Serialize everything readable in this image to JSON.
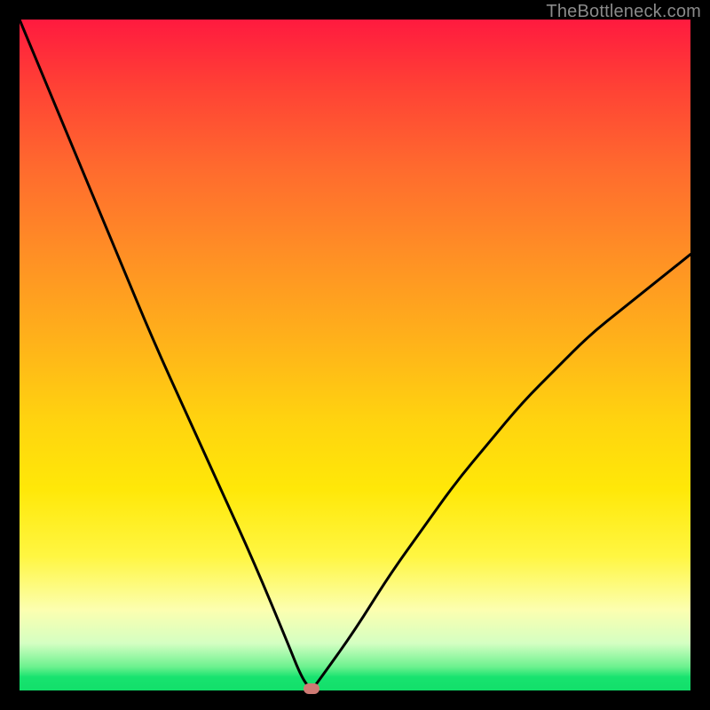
{
  "watermark": "TheBottleneck.com",
  "colors": {
    "frame": "#000000",
    "curve": "#000000",
    "marker": "#cf7a74",
    "gradient_top": "#ff1a3f",
    "gradient_bottom": "#12df6a"
  },
  "chart_data": {
    "type": "line",
    "title": "",
    "xlabel": "",
    "ylabel": "",
    "xlim": [
      0,
      100
    ],
    "ylim": [
      0,
      100
    ],
    "grid": false,
    "legend": false,
    "series": [
      {
        "name": "bottleneck-curve",
        "x": [
          0,
          5,
          10,
          15,
          20,
          25,
          30,
          35,
          40,
          42,
          43.5,
          45,
          50,
          55,
          60,
          65,
          70,
          75,
          80,
          85,
          90,
          95,
          100
        ],
        "values": [
          100,
          88,
          76,
          64,
          52,
          41,
          30,
          19,
          7,
          2,
          0,
          2,
          9,
          17,
          24,
          31,
          37,
          43,
          48,
          53,
          57,
          61,
          65
        ]
      }
    ],
    "annotations": [
      {
        "name": "optimum-marker",
        "x": 43.5,
        "y": 0
      }
    ]
  }
}
